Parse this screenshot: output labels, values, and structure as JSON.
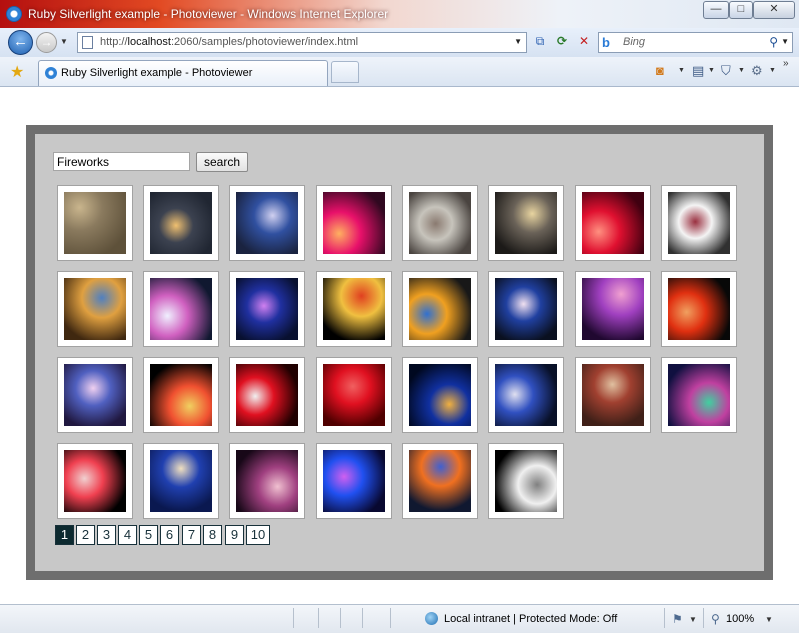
{
  "window": {
    "title": "Ruby Silverlight example - Photoviewer - Windows Internet Explorer",
    "min_glyph": "—",
    "max_glyph": "□",
    "close_glyph": "✕"
  },
  "address": {
    "url_prefix": "http://",
    "url_host": "localhost",
    "url_rest": ":2060/samples/photoviewer/index.html",
    "search_placeholder": "Bing"
  },
  "tab": {
    "label": "Ruby Silverlight example - Photoviewer"
  },
  "app": {
    "query": "Fireworks",
    "search_label": "search",
    "photos": [
      {
        "icon": "photo-crowd-pattern",
        "colors": [
          "#8a7a5e",
          "#c9b58d",
          "#5e513a"
        ]
      },
      {
        "icon": "photo-fireworks-harbor",
        "colors": [
          "#3c4250",
          "#f0c070",
          "#202632"
        ]
      },
      {
        "icon": "photo-city-skyline",
        "colors": [
          "#3050a0",
          "#d0d0f0",
          "#1a2340"
        ]
      },
      {
        "icon": "photo-red-bursts",
        "colors": [
          "#e8106a",
          "#ffb060",
          "#300820"
        ]
      },
      {
        "icon": "photo-people-crowd",
        "colors": [
          "#c7c4bc",
          "#8a7a70",
          "#4a4440"
        ]
      },
      {
        "icon": "photo-bridge-night",
        "colors": [
          "#6a6258",
          "#e8d4a0",
          "#1c1a18"
        ]
      },
      {
        "icon": "photo-red-fireworks",
        "colors": [
          "#e01030",
          "#ff9080",
          "#400010"
        ]
      },
      {
        "icon": "photo-collage",
        "colors": [
          "#f4f4f4",
          "#9a3040",
          "#303030"
        ]
      },
      {
        "icon": "photo-dandelion",
        "colors": [
          "#e0a040",
          "#5080c0",
          "#402810"
        ]
      },
      {
        "icon": "photo-opera-house",
        "colors": [
          "#d060c0",
          "#f0f0ff",
          "#101830"
        ]
      },
      {
        "icon": "photo-blue-burst",
        "colors": [
          "#2030a0",
          "#d080f0",
          "#081030"
        ]
      },
      {
        "icon": "photo-golden-shower",
        "colors": [
          "#f0c040",
          "#e04020",
          "#000000"
        ]
      },
      {
        "icon": "photo-cartoon-fireworks",
        "colors": [
          "#f0a020",
          "#3070d0",
          "#181818"
        ]
      },
      {
        "icon": "photo-bridge-lights",
        "colors": [
          "#2040a0",
          "#f0e0f0",
          "#0a1020"
        ]
      },
      {
        "icon": "photo-castle-fireworks",
        "colors": [
          "#a040c0",
          "#f0a0d0",
          "#200830"
        ]
      },
      {
        "icon": "photo-red-fountain",
        "colors": [
          "#e03010",
          "#f0a060",
          "#080808"
        ]
      },
      {
        "icon": "photo-disney-castle",
        "colors": [
          "#5060c0",
          "#f0d0f0",
          "#201840"
        ]
      },
      {
        "icon": "photo-sparkle-palm",
        "colors": [
          "#f05030",
          "#f0d060",
          "#000000"
        ]
      },
      {
        "icon": "photo-red-starburst",
        "colors": [
          "#e01020",
          "#f0f0f0",
          "#200000"
        ]
      },
      {
        "icon": "photo-red-sky",
        "colors": [
          "#e01020",
          "#f06060",
          "#500000"
        ]
      },
      {
        "icon": "photo-harbor-dusk",
        "colors": [
          "#1030a0",
          "#f0b040",
          "#000820"
        ]
      },
      {
        "icon": "photo-multi-burst",
        "colors": [
          "#3050c0",
          "#e0e0f0",
          "#081028"
        ]
      },
      {
        "icon": "photo-interior",
        "colors": [
          "#a04030",
          "#e0c0a0",
          "#402018"
        ]
      },
      {
        "icon": "photo-colorful-bay",
        "colors": [
          "#c040a0",
          "#40d0a0",
          "#101040"
        ]
      },
      {
        "icon": "photo-red-pinwheel",
        "colors": [
          "#f04050",
          "#f0d0d0",
          "#000000"
        ]
      },
      {
        "icon": "photo-willow-burst",
        "colors": [
          "#2040b0",
          "#f0e0c0",
          "#0a1850"
        ]
      },
      {
        "icon": "photo-tower-burst",
        "colors": [
          "#a04080",
          "#f0c0d0",
          "#180818"
        ]
      },
      {
        "icon": "photo-blue-castle",
        "colors": [
          "#2050f0",
          "#d060f0",
          "#080830"
        ]
      },
      {
        "icon": "photo-bridge-finale",
        "colors": [
          "#f07020",
          "#4060d0",
          "#101830"
        ]
      },
      {
        "icon": "photo-bw-burst",
        "colors": [
          "#f0f0f0",
          "#808080",
          "#000000"
        ]
      }
    ],
    "pages": [
      "1",
      "2",
      "3",
      "4",
      "5",
      "6",
      "7",
      "8",
      "9",
      "10"
    ],
    "current_page": "1"
  },
  "status": {
    "zone": "Local intranet | Protected Mode: Off",
    "zoom": "100%"
  },
  "colors": {
    "frame": "#6e6e6e",
    "panel": "#c8c8c8",
    "page_active": "#0d2a30"
  }
}
